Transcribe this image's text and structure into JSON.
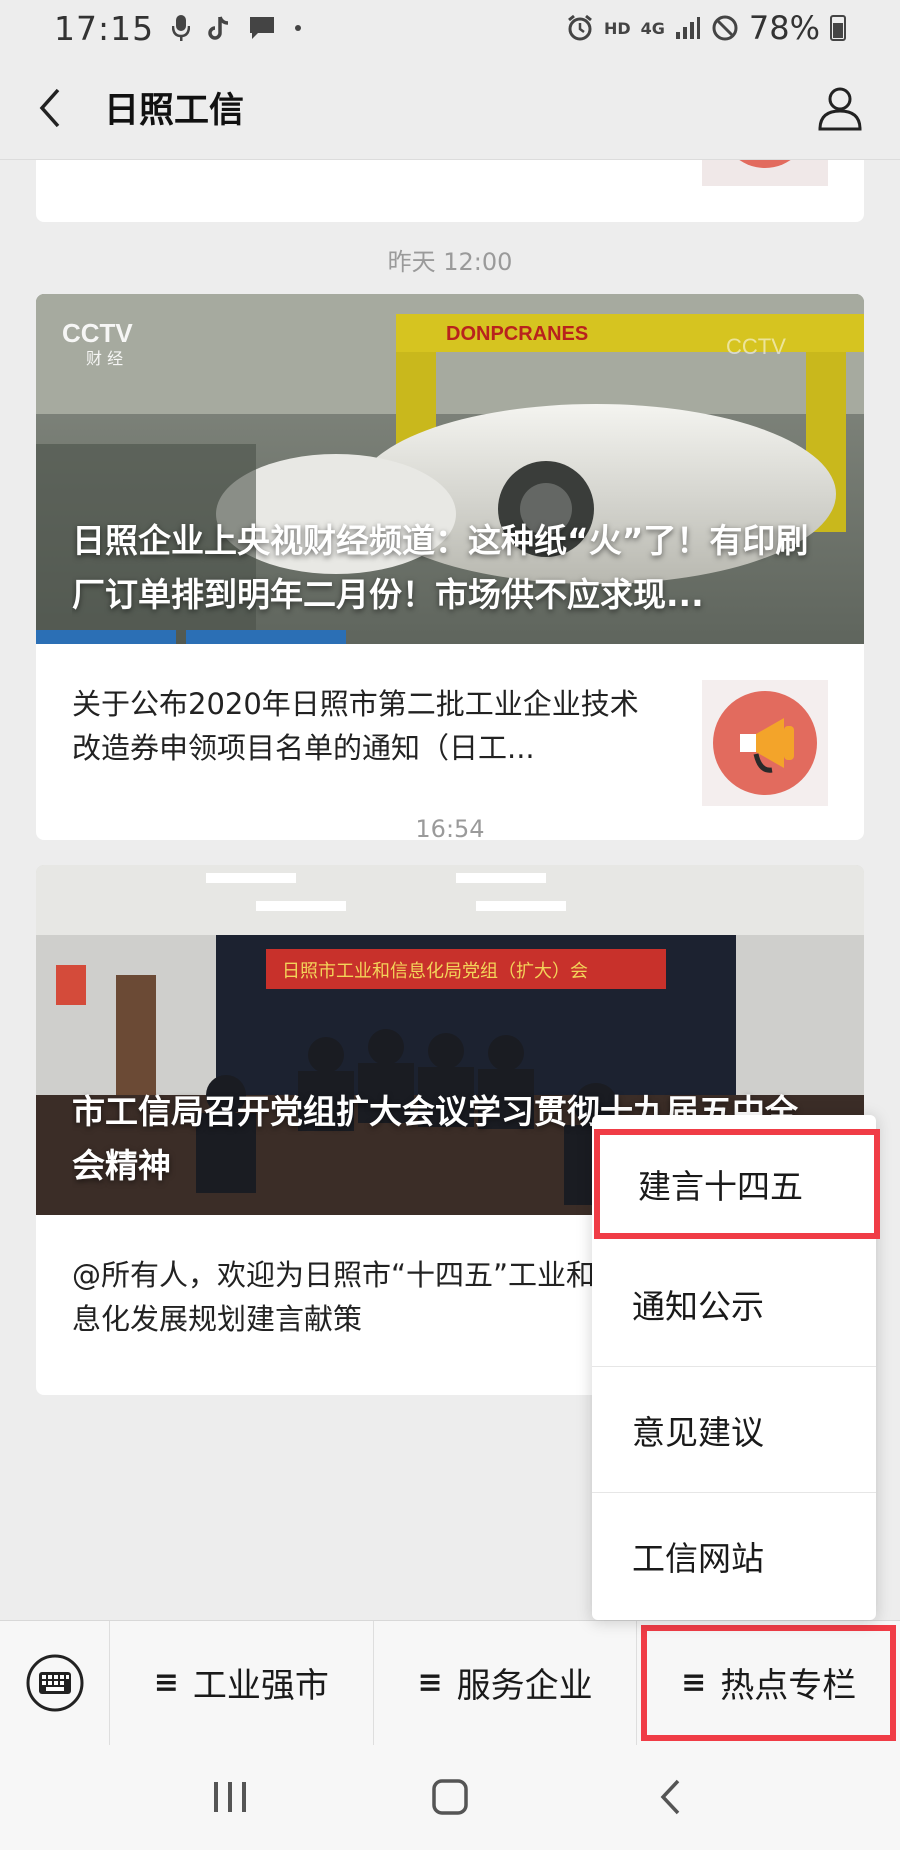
{
  "status_bar": {
    "time": "17:15",
    "left_icons": [
      "mic-icon",
      "tiktok-icon",
      "message-icon",
      "dot-icon"
    ],
    "network": "HD",
    "network_type": "4G",
    "battery": "78%"
  },
  "title_bar": {
    "title": "日照工信"
  },
  "feed": [
    {
      "timestamp": "昨天 12:00",
      "hero_title": "日照企业上央视财经频道：这种纸“火”了！有印刷厂订单排到明年二月份！市场供不应求现...",
      "sub_title": "关于公布2020年日照市第二批工业企业技术改造券申领项目名单的通知（日工..."
    },
    {
      "timestamp": "16:54",
      "hero_title": "市工信局召开党组扩大会议学习贯彻十九届五中全会精神",
      "sub_title": "@所有人，欢迎为日照市“十四五”工业和信息化发展规划建言献策"
    }
  ],
  "popup_menu": {
    "items": [
      {
        "label": "建言十四五"
      },
      {
        "label": "通知公示"
      },
      {
        "label": "意见建议"
      },
      {
        "label": "工信网站"
      }
    ]
  },
  "menu_bar": {
    "buttons": [
      {
        "label": "工业强市"
      },
      {
        "label": "服务企业"
      },
      {
        "label": "热点专栏"
      }
    ]
  },
  "colors": {
    "highlight": "#f03c46",
    "background": "#ededed",
    "card": "#ffffff"
  }
}
